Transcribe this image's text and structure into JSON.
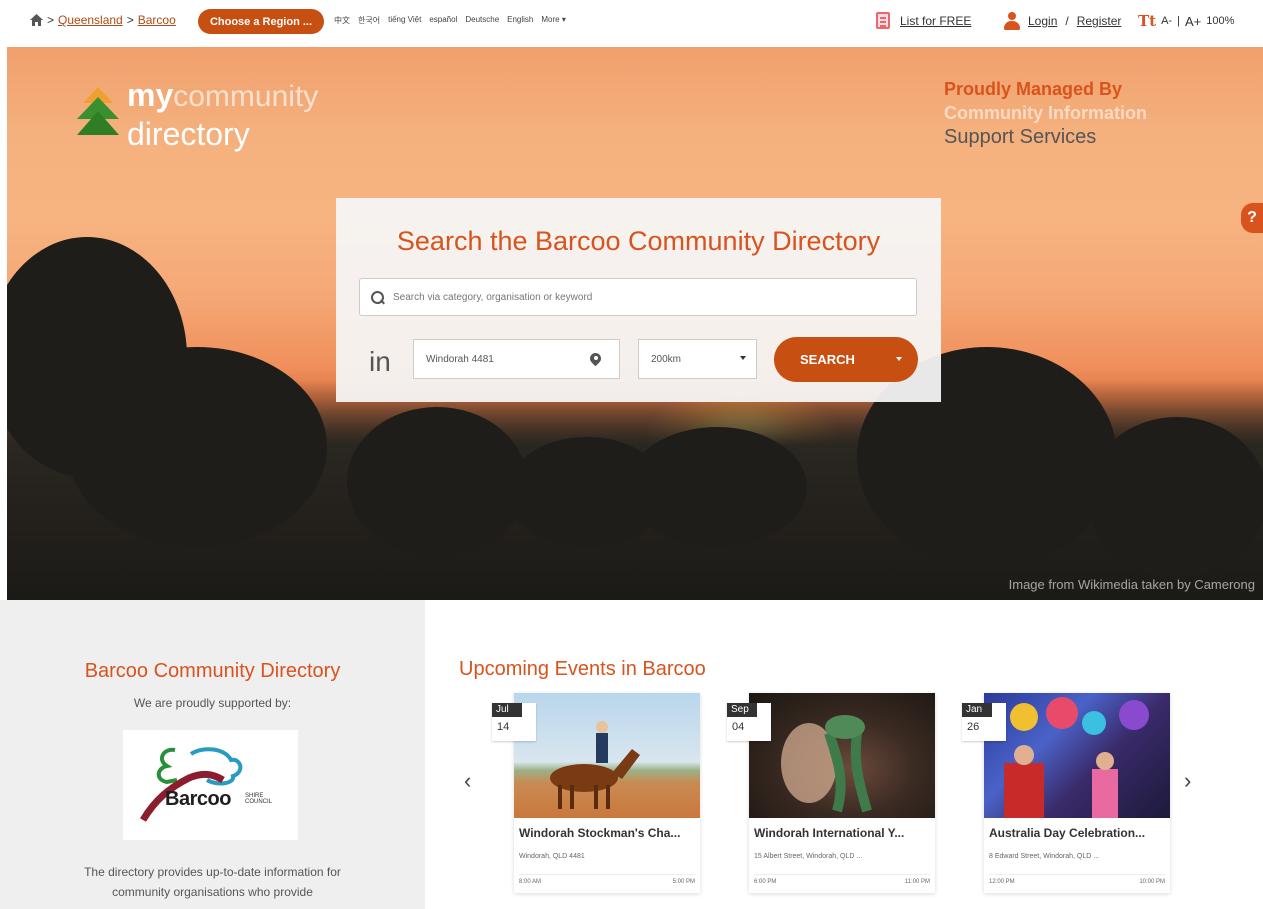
{
  "breadcrumb": {
    "separator": ">",
    "state": "Queensland",
    "area": "Barcoo"
  },
  "region_button": "Choose a Region ...",
  "languages": [
    "中文",
    "한국어",
    "tiếng Việt",
    "español",
    "Deutsche",
    "English",
    "More ▾"
  ],
  "top_right": {
    "list_free": "List for FREE",
    "login": "Login",
    "login_sep": "/",
    "register": "Register",
    "font_small": "A-",
    "font_sep": "|",
    "font_large": "A+",
    "zoom": "100%"
  },
  "logo": {
    "my": "my",
    "community": "community",
    "directory": "directory"
  },
  "managed": {
    "line1": "Proudly Managed By",
    "line2": "Community Information",
    "line3": "Support Services"
  },
  "help": "?",
  "search": {
    "title": "Search the Barcoo Community Directory",
    "placeholder": "Search via category, organisation or keyword",
    "in_label": "in",
    "location": "Windorah 4481",
    "distance": "200km",
    "button": "SEARCH"
  },
  "image_credit": "Image from Wikimedia taken by Camerong",
  "left_panel": {
    "title": "Barcoo Community Directory",
    "subtitle": "We are proudly supported by:",
    "sponsor_name": "Barcoo",
    "sponsor_small": "SHIRE COUNCIL",
    "description": "The directory provides up-to-date information for community organisations who provide"
  },
  "events": {
    "title": "Upcoming Events in Barcoo",
    "prev": "‹",
    "next": "›",
    "items": [
      {
        "month": "Jul",
        "day": "14",
        "name": "Windorah Stockman's Cha...",
        "address": "Windorah, QLD 4481",
        "start": "8:00 AM",
        "end": "5:00 PM"
      },
      {
        "month": "Sep",
        "day": "04",
        "name": "Windorah International Y...",
        "address": "15 Albert Street, Windorah, QLD ...",
        "start": "6:00 PM",
        "end": "11:00 PM"
      },
      {
        "month": "Jan",
        "day": "26",
        "name": "Australia Day Celebration...",
        "address": "8 Edward Street, Windorah, QLD ...",
        "start": "12:00 PM",
        "end": "10:00 PM"
      }
    ]
  },
  "colors": {
    "accent": "#d9531e",
    "button": "#c84f12"
  }
}
